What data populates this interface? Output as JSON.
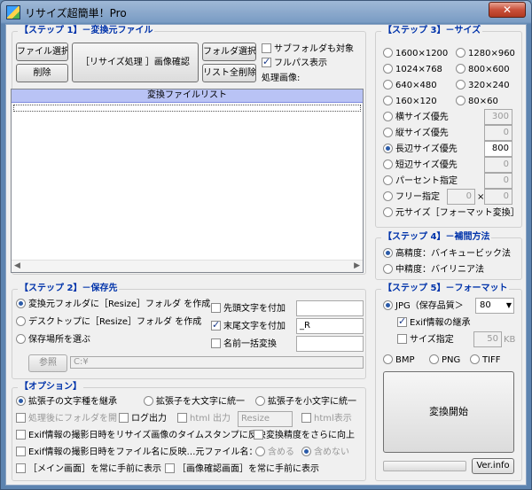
{
  "window": {
    "title": "リサイズ超簡単！Pro",
    "close_label": "✕"
  },
  "step1": {
    "title": "【ステップ 1】－変換元ファイル",
    "file_select": "ファイル選択",
    "delete": "削除",
    "confirm": "［リサイズ処理 ］画像確認",
    "folder_select": "フォルダ選択",
    "delete_all": "リスト全削除",
    "subfolder": "サブフォルダも対象",
    "fullpath": "フルパス表示",
    "processing_label": "処理画像:",
    "list_header": "変換ファイルリスト"
  },
  "step2": {
    "title": "【ステップ 2】－保存先",
    "opt_source": "変換元フォルダに［Resize］フォルダ を作成",
    "opt_desktop": "デスクトップに［Resize］フォルダ を作成",
    "opt_choose": "保存場所を選ぶ",
    "prefix": "先頭文字を付加",
    "suffix": "末尾文字を付加",
    "suffix_value": "_R",
    "rename": "名前一括変換",
    "browse": "参照",
    "path": "C:¥"
  },
  "step3": {
    "title": "【ステップ 3】－サイズ",
    "sizes": [
      "1600×1200",
      "1280×960",
      "1024×768",
      "800×600",
      "640×480",
      "320×240",
      "160×120",
      "80×60"
    ],
    "width_priority": "横サイズ優先",
    "width_value": "300",
    "height_priority": "縦サイズ優先",
    "height_value": "0",
    "long_priority": "長辺サイズ優先",
    "long_value": "800",
    "short_priority": "短辺サイズ優先",
    "short_value": "0",
    "percent": "パーセント指定",
    "percent_value": "0",
    "free": "フリー指定",
    "free_w": "0",
    "times": "×",
    "free_h": "0",
    "original": "元サイズ［フォーマット変換］"
  },
  "step4": {
    "title": "【ステップ 4】－補間方法",
    "bicubic": "高精度：バイキュービック法",
    "bilinear": "中精度：バイリニア法"
  },
  "step5": {
    "title": "【ステップ 5】－フォーマット",
    "jpg": "JPG（保存品質＞",
    "quality": "80",
    "exif": "Exif情報の継承",
    "size_spec": "サイズ指定",
    "size_value": "50",
    "size_unit": "KB",
    "bmp": "BMP",
    "png": "PNG",
    "tiff": "TIFF",
    "start": "変換開始",
    "ver": "Ver.info"
  },
  "options": {
    "title": "【オプション】",
    "keep_ext": "拡張子の文字種を継承",
    "ext_upper": "拡張子を大文字に統一",
    "ext_lower": "拡張子を小文字に統一",
    "open_folder": "処理後にフォルダを開く",
    "log": "ログ出力",
    "html_out": "html 出力",
    "html_value": "Resize",
    "html_view": "html表示",
    "exif_timestamp": "Exif情報の撮影日時をリサイズ画像のタイムスタンプに反映",
    "precision": "変換精度をさらに向上",
    "exif_filename": "Exif情報の撮影日時をファイル名に反映…元ファイル名：",
    "include": "含める",
    "exclude": "含めない",
    "main_front": "［メイン画面］を常に手前に表示",
    "confirm_front": "［画像確認画面］を常に手前に表示"
  }
}
